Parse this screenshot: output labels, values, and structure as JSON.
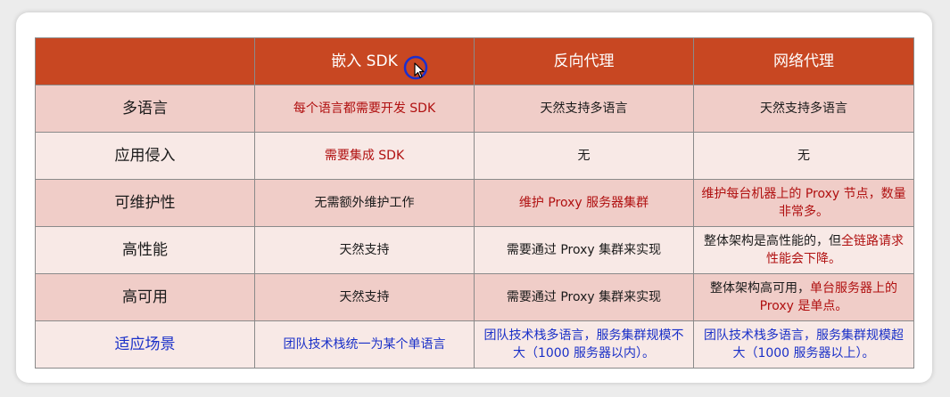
{
  "header": {
    "col0": "",
    "col1": "嵌入 SDK",
    "col2": "反向代理",
    "col3": "网络代理"
  },
  "rows": [
    {
      "label": "多语言",
      "cells": [
        "每个语言都需要开发 SDK",
        "天然支持多语言",
        "天然支持多语言"
      ]
    },
    {
      "label": "应用侵入",
      "cells": [
        "需要集成 SDK",
        "无",
        "无"
      ]
    },
    {
      "label": "可维护性",
      "cells": [
        "无需额外维护工作",
        "维护 Proxy 服务器集群",
        "维护每台机器上的 Proxy 节点，数量非常多。"
      ]
    },
    {
      "label": "高性能",
      "cells": [
        "天然支持",
        "需要通过 Proxy 集群来实现",
        [
          "整体架构是高性能的，但",
          "全链路请求性能会下降。"
        ]
      ]
    },
    {
      "label": "高可用",
      "cells": [
        "天然支持",
        "需要通过 Proxy 集群来实现",
        [
          "整体架构高可用，",
          "单台服务器上的 Proxy 是单点。"
        ]
      ]
    },
    {
      "label": "适应场景",
      "cells": [
        "团队技术栈统一为某个单语言",
        "团队技术栈多语言，服务集群规模不大（1000 服务器以内）。",
        "团队技术栈多语言，服务集群规模超大（1000 服务器以上）。"
      ]
    }
  ]
}
